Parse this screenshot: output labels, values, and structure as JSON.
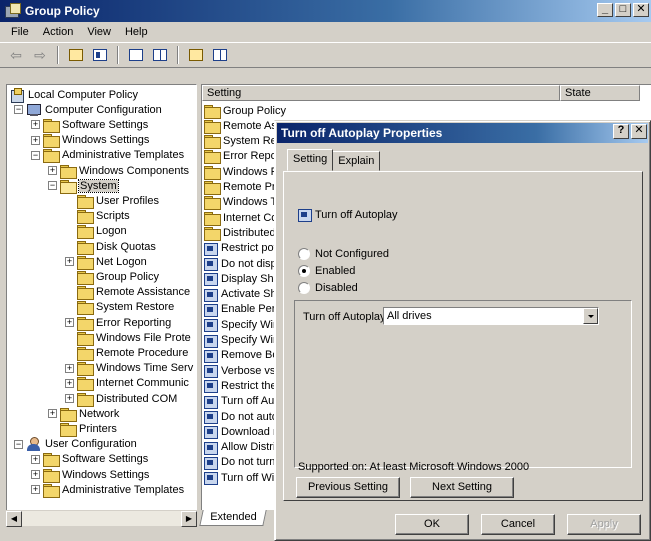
{
  "window": {
    "title": "Group Policy",
    "controls": [
      "_",
      "□",
      "✕"
    ]
  },
  "menu": [
    "File",
    "Action",
    "View",
    "Help"
  ],
  "tree": {
    "rows": [
      {
        "label": "Local Computer Policy",
        "depth": 0,
        "icon": "policy",
        "expander": ""
      },
      {
        "label": "Computer Configuration",
        "depth": 1,
        "icon": "pc",
        "expander": "-"
      },
      {
        "label": "Software Settings",
        "depth": 2,
        "icon": "folder",
        "expander": "+"
      },
      {
        "label": "Windows Settings",
        "depth": 2,
        "icon": "folder",
        "expander": "+"
      },
      {
        "label": "Administrative Templates",
        "depth": 2,
        "icon": "folder",
        "expander": "-"
      },
      {
        "label": "Windows Components",
        "depth": 3,
        "icon": "folder",
        "expander": "+"
      },
      {
        "label": "System",
        "depth": 3,
        "icon": "folder-open",
        "expander": "-",
        "selected": true
      },
      {
        "label": "User Profiles",
        "depth": 4,
        "icon": "folder",
        "expander": ""
      },
      {
        "label": "Scripts",
        "depth": 4,
        "icon": "folder",
        "expander": ""
      },
      {
        "label": "Logon",
        "depth": 4,
        "icon": "folder",
        "expander": ""
      },
      {
        "label": "Disk Quotas",
        "depth": 4,
        "icon": "folder",
        "expander": ""
      },
      {
        "label": "Net Logon",
        "depth": 4,
        "icon": "folder",
        "expander": "+"
      },
      {
        "label": "Group Policy",
        "depth": 4,
        "icon": "folder",
        "expander": ""
      },
      {
        "label": "Remote Assistance",
        "depth": 4,
        "icon": "folder",
        "expander": ""
      },
      {
        "label": "System Restore",
        "depth": 4,
        "icon": "folder",
        "expander": ""
      },
      {
        "label": "Error Reporting",
        "depth": 4,
        "icon": "folder",
        "expander": "+"
      },
      {
        "label": "Windows File Prote",
        "depth": 4,
        "icon": "folder",
        "expander": ""
      },
      {
        "label": "Remote Procedure",
        "depth": 4,
        "icon": "folder",
        "expander": ""
      },
      {
        "label": "Windows Time Serv",
        "depth": 4,
        "icon": "folder",
        "expander": "+"
      },
      {
        "label": "Internet Communic",
        "depth": 4,
        "icon": "folder",
        "expander": "+"
      },
      {
        "label": "Distributed COM",
        "depth": 4,
        "icon": "folder",
        "expander": "+"
      },
      {
        "label": "Network",
        "depth": 3,
        "icon": "folder",
        "expander": "+"
      },
      {
        "label": "Printers",
        "depth": 3,
        "icon": "folder",
        "expander": ""
      },
      {
        "label": "User Configuration",
        "depth": 1,
        "icon": "user",
        "expander": "-"
      },
      {
        "label": "Software Settings",
        "depth": 2,
        "icon": "folder",
        "expander": "+"
      },
      {
        "label": "Windows Settings",
        "depth": 2,
        "icon": "folder",
        "expander": "+"
      },
      {
        "label": "Administrative Templates",
        "depth": 2,
        "icon": "folder",
        "expander": "+"
      }
    ]
  },
  "list": {
    "col_setting": "Setting",
    "col_state": "State",
    "rows": [
      {
        "label": "Group Policy",
        "icon": "folder"
      },
      {
        "label": "Remote Ass",
        "icon": "folder"
      },
      {
        "label": "System Res",
        "icon": "folder"
      },
      {
        "label": "Error Repor",
        "icon": "folder"
      },
      {
        "label": "Windows Fil",
        "icon": "folder"
      },
      {
        "label": "Remote Pro",
        "icon": "folder"
      },
      {
        "label": "Windows Tir",
        "icon": "folder"
      },
      {
        "label": "Internet Co",
        "icon": "folder"
      },
      {
        "label": "Distributed",
        "icon": "folder"
      },
      {
        "label": "Restrict pot",
        "icon": "policy"
      },
      {
        "label": "Do not displ",
        "icon": "policy"
      },
      {
        "label": "Display Shul",
        "icon": "policy"
      },
      {
        "label": "Activate Sh",
        "icon": "policy"
      },
      {
        "label": "Enable Pers",
        "icon": "policy"
      },
      {
        "label": "Specify Win",
        "icon": "policy"
      },
      {
        "label": "Specify Win",
        "icon": "policy"
      },
      {
        "label": "Remove Bo",
        "icon": "policy"
      },
      {
        "label": "Verbose vs",
        "icon": "policy"
      },
      {
        "label": "Restrict the",
        "icon": "policy"
      },
      {
        "label": "Turn off Aut",
        "icon": "policy"
      },
      {
        "label": "Do not auto",
        "icon": "policy"
      },
      {
        "label": "Download m",
        "icon": "policy"
      },
      {
        "label": "Allow Distrib",
        "icon": "policy"
      },
      {
        "label": "Do not turn",
        "icon": "policy"
      },
      {
        "label": "Turn off Wir",
        "icon": "policy"
      }
    ],
    "bottom_tab": "Extended"
  },
  "dialog": {
    "title": "Turn off Autoplay Properties",
    "help_btn": "?",
    "close_btn": "✕",
    "tabs": [
      "Setting",
      "Explain"
    ],
    "policy_name": "Turn off Autoplay",
    "radios": [
      {
        "label": "Not Configured",
        "checked": false
      },
      {
        "label": "Enabled",
        "checked": true
      },
      {
        "label": "Disabled",
        "checked": false
      }
    ],
    "option_label": "Turn off Autoplay on:",
    "option_value": "All drives",
    "supported": "Supported on:   At least Microsoft Windows 2000",
    "prev_btn": "Previous Setting",
    "next_btn": "Next Setting",
    "ok_btn": "OK",
    "cancel_btn": "Cancel",
    "apply_btn": "Apply"
  }
}
